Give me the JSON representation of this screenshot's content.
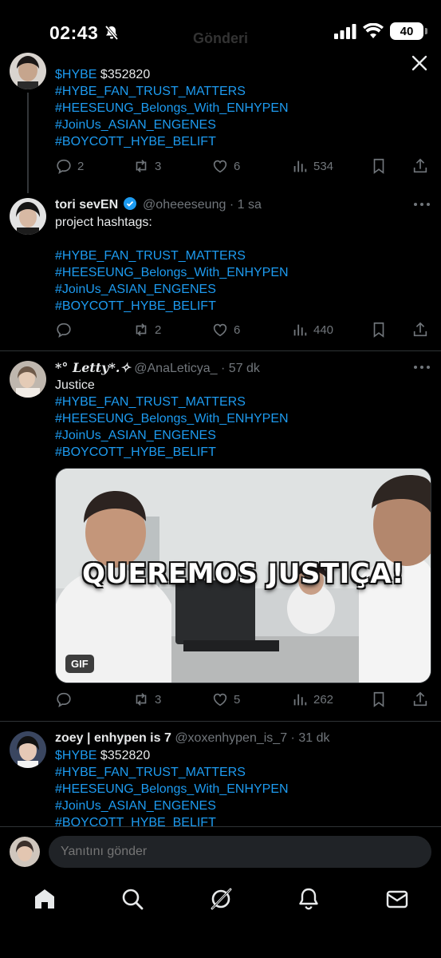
{
  "status_bar": {
    "time": "02:43",
    "battery": "40",
    "faded_title": "Gönderi"
  },
  "tweets": [
    {
      "name": "",
      "handle": "",
      "time": "",
      "lines": [
        "$HYBE $352820",
        "#HYBE_FAN_TRUST_MATTERS",
        "#HEESEUNG_Belongs_With_ENHYPEN",
        "#JoinUs_ASIAN_ENGENES",
        "#BOYCOTT_HYBE_BELIFT"
      ],
      "cashtag": "$HYBE",
      "cashtag_rest": "$352820",
      "replies": "2",
      "retweets": "3",
      "likes": "6",
      "views": "534"
    },
    {
      "name": "tori sevEN",
      "handle": "@oheeeseung",
      "time": "· 1 sa",
      "text": "project hashtags:",
      "tags": [
        "#HYBE_FAN_TRUST_MATTERS",
        "#HEESEUNG_Belongs_With_ENHYPEN",
        "#JoinUs_ASIAN_ENGENES",
        "#BOYCOTT_HYBE_BELIFT"
      ],
      "replies": "",
      "retweets": "2",
      "likes": "6",
      "views": "440"
    },
    {
      "name": "*° 𝑳𝒆𝒕𝒕𝒚*.✧",
      "handle": "@AnaLeticya_",
      "time": "· 57 dk",
      "text": "Justice",
      "tags": [
        "#HYBE_FAN_TRUST_MATTERS",
        "#HEESEUNG_Belongs_With_ENHYPEN",
        "#JoinUs_ASIAN_ENGENES",
        "#BOYCOTT_HYBE_BELIFT"
      ],
      "media_caption": "QUEREMOS JUSTIÇA!",
      "media_badge": "GIF",
      "replies": "",
      "retweets": "3",
      "likes": "5",
      "views": "262"
    },
    {
      "name": "zoey | enhypen is 7",
      "handle": "@xoxenhypen_is_7",
      "time": "· 31 dk",
      "cashtag": "$HYBE",
      "cashtag_rest": "$352820",
      "tags": [
        "#HYBE_FAN_TRUST_MATTERS",
        "#HEESEUNG_Belongs_With_ENHYPEN",
        "#JoinUs_ASIAN_ENGENES",
        "#BOYCOTT_HYBE_BELIFT"
      ]
    }
  ],
  "reply": {
    "placeholder": "Yanıtını gönder"
  },
  "colors": {
    "background": "#000000",
    "link": "#1d9bf0",
    "muted": "#71767b",
    "verified": "#1d9bf0"
  },
  "nav": [
    "home-icon",
    "search-icon",
    "grok-icon",
    "notifications-icon",
    "messages-icon"
  ]
}
